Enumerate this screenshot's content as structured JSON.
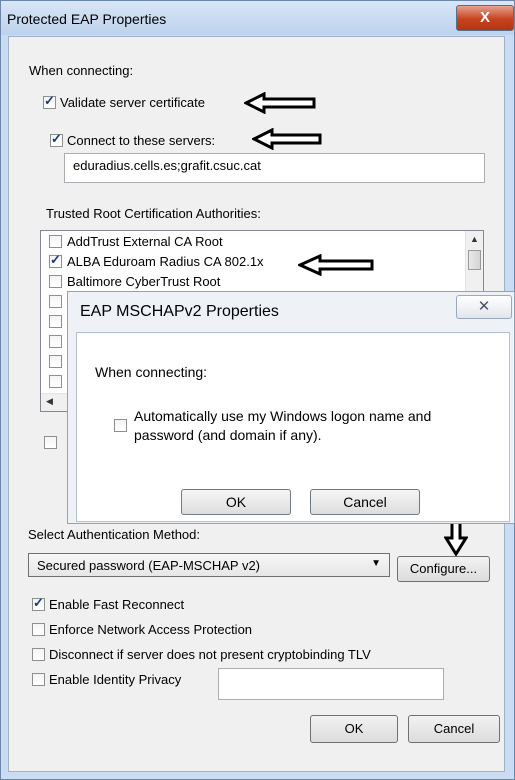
{
  "window": {
    "title": "Protected EAP Properties",
    "close_glyph": "X"
  },
  "section": {
    "when_connecting": "When connecting:"
  },
  "checkboxes": {
    "validate": {
      "label": "Validate server certificate",
      "checked": true
    },
    "connect_servers": {
      "label": "Connect to these servers:",
      "checked": true
    }
  },
  "servers_field": {
    "value": "eduradius.cells.es;grafit.csuc.cat"
  },
  "trusted_root": {
    "label": "Trusted Root Certification Authorities:",
    "items": [
      {
        "label": "AddTrust External CA Root",
        "checked": false
      },
      {
        "label": "ALBA Eduroam Radius CA 802.1x",
        "checked": true
      },
      {
        "label": "Baltimore CyberTrust Root",
        "checked": false
      }
    ]
  },
  "auth": {
    "label": "Select Authentication Method:",
    "method": "Secured password (EAP-MSCHAP v2)",
    "configure": "Configure..."
  },
  "options": [
    {
      "label": "Enable Fast Reconnect",
      "checked": true
    },
    {
      "label": "Enforce Network Access Protection",
      "checked": false
    },
    {
      "label": "Disconnect if server does not present cryptobinding TLV",
      "checked": false
    },
    {
      "label": "Enable Identity Privacy",
      "checked": false
    }
  ],
  "buttons": {
    "ok": "OK",
    "cancel": "Cancel"
  },
  "mschap": {
    "title": "EAP MSCHAPv2 Properties",
    "when_connecting": "When connecting:",
    "auto_line1": "Automatically use my Windows logon name and",
    "auto_line2": "password (and domain if any).",
    "ok": "OK",
    "cancel": "Cancel"
  },
  "icons": {
    "close": "close-icon",
    "arrow_up": "arrow-up-icon",
    "arrow_down": "arrow-down-icon",
    "arrow_left": "arrow-left-icon",
    "dropdown": "chevron-down-icon"
  }
}
